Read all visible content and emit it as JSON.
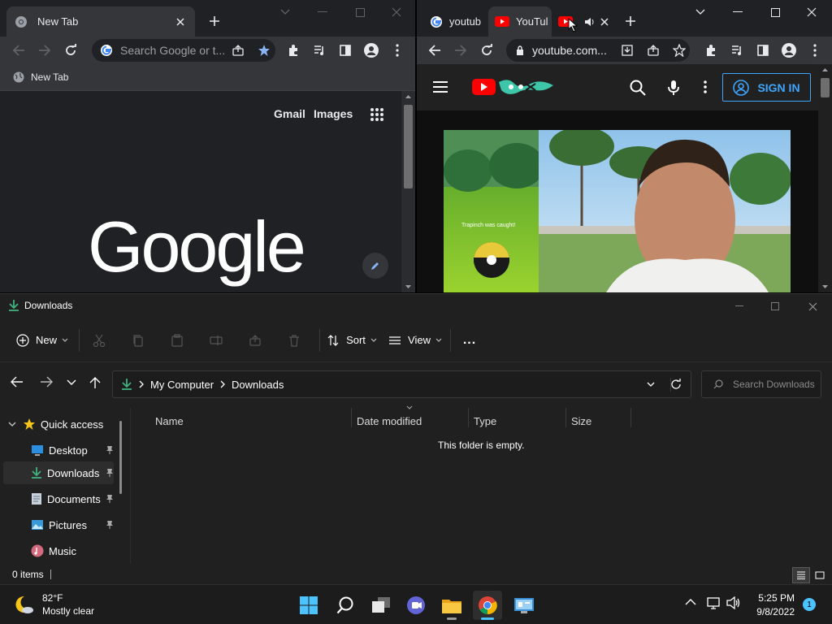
{
  "left_browser": {
    "tab_title": "New Tab",
    "omnibox_placeholder": "Search Google or t...",
    "bookmark": "New Tab",
    "header_links": [
      "Gmail",
      "Images"
    ],
    "logo_text": "Google"
  },
  "right_browser": {
    "tabs": [
      {
        "title": "youtub",
        "icon": "google-g-icon"
      },
      {
        "title": "YouTul",
        "icon": "youtube-icon"
      },
      {
        "title": "",
        "icon": "youtube-icon"
      }
    ],
    "url": "youtube.com...",
    "sign_in": "SIGN IN",
    "video_overlay_text": "Trapinch was caught!"
  },
  "explorer": {
    "title": "Downloads",
    "commands": {
      "new": "New",
      "sort": "Sort",
      "view": "View",
      "more": "..."
    },
    "breadcrumb": [
      "My Computer",
      "Downloads"
    ],
    "search_placeholder": "Search Downloads",
    "columns": [
      "Name",
      "Date modified",
      "Type",
      "Size"
    ],
    "empty_message": "This folder is empty.",
    "nav": [
      {
        "label": "Quick access"
      },
      {
        "label": "Desktop"
      },
      {
        "label": "Downloads"
      },
      {
        "label": "Documents"
      },
      {
        "label": "Pictures"
      },
      {
        "label": "Music"
      }
    ],
    "status": "0 items"
  },
  "taskbar": {
    "weather_temp": "82°F",
    "weather_desc": "Mostly clear",
    "time": "5:25 PM",
    "date": "9/8/2022",
    "notification_count": "1"
  },
  "colors": {
    "chrome_dark": "#202124",
    "chrome_toolbar": "#35363a",
    "youtube_red": "#ff0000",
    "signin_blue": "#3ea6ff",
    "explorer_bg": "#202020",
    "taskbar_bg": "#1c1c1c",
    "accent_blue": "#4cc2ff"
  }
}
